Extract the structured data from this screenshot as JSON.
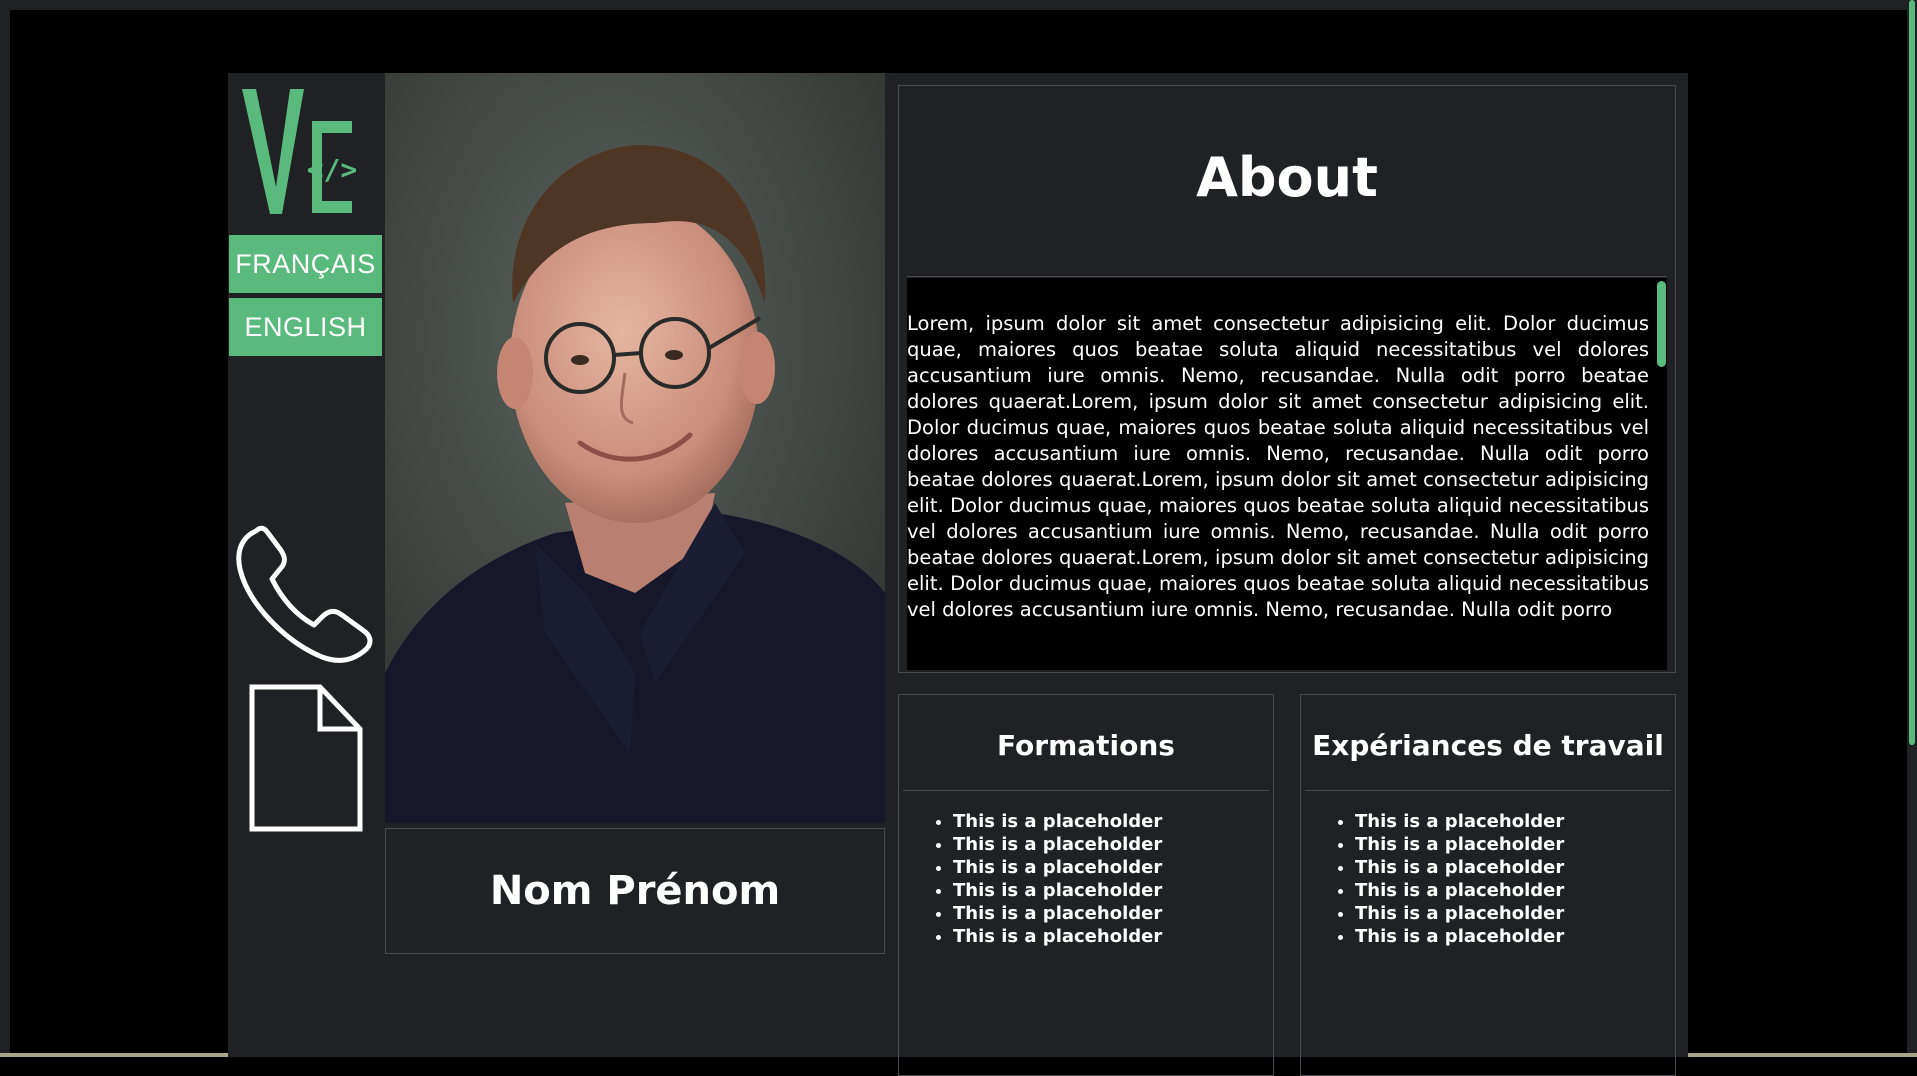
{
  "colors": {
    "accent": "#5aba7e",
    "card_background": "#202124",
    "page_background": "#000000",
    "border": "#4a4b4f",
    "text": "#ffffff"
  },
  "sidebar": {
    "logo_icon": "vc-code-logo",
    "languages": [
      "FRANÇAIS",
      "ENGLISH"
    ],
    "icons": [
      "phone-icon",
      "document-icon"
    ]
  },
  "profile": {
    "name": "Nom Prénom"
  },
  "about": {
    "title": "About",
    "text": "Lorem, ipsum dolor sit amet consectetur adipisicing elit. Dolor ducimus quae, maiores quos beatae soluta aliquid necessitatibus vel dolores accusantium iure omnis. Nemo, recusandae. Nulla odit porro beatae dolores quaerat.Lorem, ipsum dolor sit amet consectetur adipisicing elit. Dolor ducimus quae, maiores quos beatae soluta aliquid necessitatibus vel dolores accusantium iure omnis. Nemo, recusandae. Nulla odit porro beatae dolores quaerat.Lorem, ipsum dolor sit amet consectetur adipisicing elit. Dolor ducimus quae, maiores quos beatae soluta aliquid necessitatibus vel dolores accusantium iure omnis. Nemo, recusandae. Nulla odit porro beatae dolores quaerat.Lorem, ipsum dolor sit amet consectetur adipisicing elit. Dolor ducimus quae, maiores quos beatae soluta aliquid necessitatibus vel dolores accusantium iure omnis. Nemo, recusandae. Nulla odit porro"
  },
  "formations": {
    "title": "Formations",
    "items": [
      "This is a placeholder",
      "This is a placeholder",
      "This is a placeholder",
      "This is a placeholder",
      "This is a placeholder",
      "This is a placeholder"
    ]
  },
  "experiences": {
    "title": "Expériances de travail",
    "items": [
      "This is a placeholder",
      "This is a placeholder",
      "This is a placeholder",
      "This is a placeholder",
      "This is a placeholder",
      "This is a placeholder"
    ]
  }
}
